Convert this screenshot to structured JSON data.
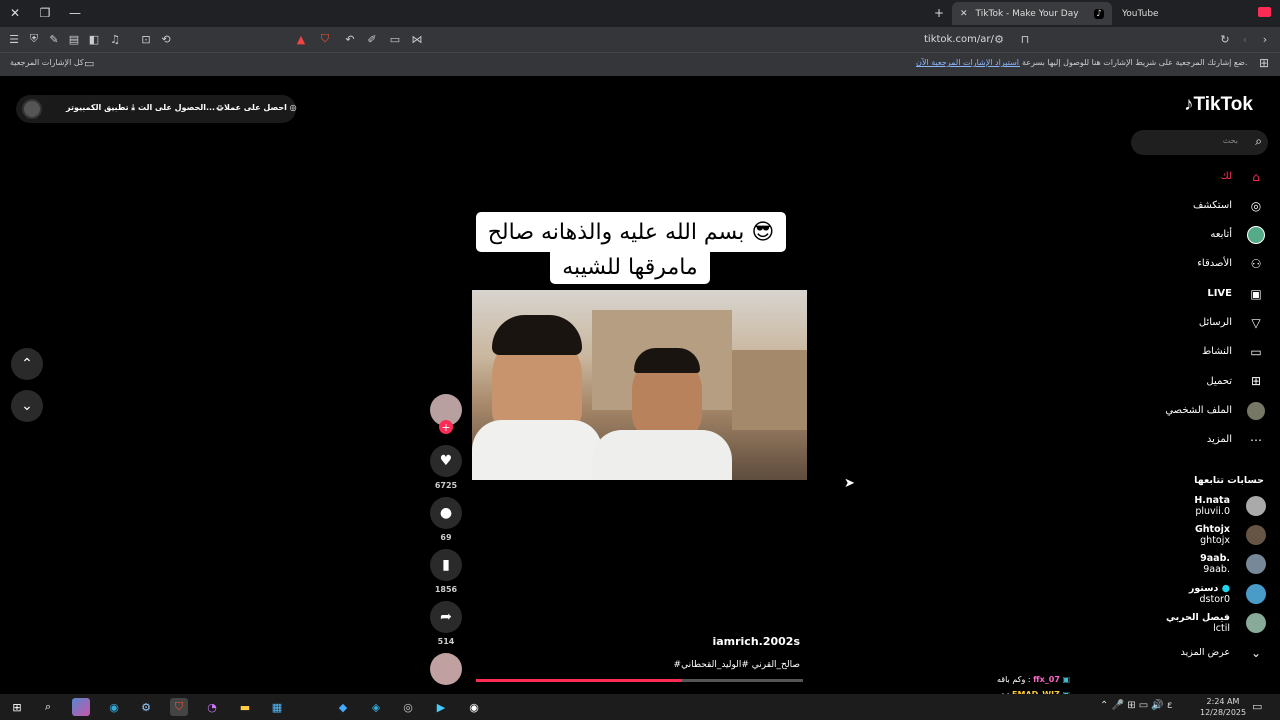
{
  "browser": {
    "tabs": [
      {
        "label": "TikTok - Make Your Day",
        "active": true
      },
      {
        "label": "YouTube",
        "active": false
      }
    ],
    "url": "tiktok.com/ar/",
    "bookmarks_all": "كل الإشارات المرجعية",
    "bookmarks_hint": "ضع إشارتك المرجعية على شريط الإشارات هنا للوصول إليها بسرعة.",
    "bookmarks_import": "استيراد الإشارات المرجعية الآن..."
  },
  "top_links": {
    "coins": "احصل على عملات",
    "get_app": "الحصول على الت...",
    "desktop_app": "تطبيق الكمبيوتر"
  },
  "sidebar": {
    "logo": "TikTok",
    "search_placeholder": "بحث",
    "items": [
      {
        "label": "لك",
        "icon": "home-icon"
      },
      {
        "label": "استكشف",
        "icon": "compass-icon"
      },
      {
        "label": "أتابعه",
        "icon": "following-icon"
      },
      {
        "label": "الأصدقاء",
        "icon": "friends-icon"
      },
      {
        "label": "LIVE",
        "icon": "live-icon"
      },
      {
        "label": "الرسائل",
        "icon": "send-icon"
      },
      {
        "label": "النشاط",
        "icon": "message-icon"
      },
      {
        "label": "تحميل",
        "icon": "upload-icon"
      },
      {
        "label": "الملف الشخصي",
        "icon": "profile-icon"
      },
      {
        "label": "المزيد",
        "icon": "more-icon"
      }
    ],
    "following_header": "حسابات تتابعها",
    "following": [
      {
        "name": "H.nata",
        "user": "pluvii.0"
      },
      {
        "name": "Ghtojx",
        "user": "ghtojx"
      },
      {
        "name": "9aab.",
        "user": "9aab."
      },
      {
        "name": "دستور",
        "user": "dstor0"
      },
      {
        "name": "فيصل الحربي",
        "user": "lctil"
      }
    ],
    "show_more": "عرض المزيد"
  },
  "video": {
    "caption_line1": "بسم الله عليه والذهانه صالح 😎",
    "caption_line2": "مامرقها للشيبه",
    "author": "iamrich.2002s",
    "hashtags": "#صالح_القرني #الوليد_القحطاني",
    "progress": 0.63,
    "likes": "6725",
    "comments": "69",
    "saves": "1856",
    "shares": "514"
  },
  "chat": [
    {
      "user": "ffx_07",
      "msg": "وكم باقه",
      "color": "#ff66cc"
    },
    {
      "user": "EMAD_WIZ",
      "msg": "تو",
      "color": "#ffcc33"
    }
  ],
  "clock": {
    "time": "2:24 AM",
    "date": "12/28/2025"
  },
  "colors": {
    "accent": "#fe2c55",
    "bg": "#000000"
  }
}
